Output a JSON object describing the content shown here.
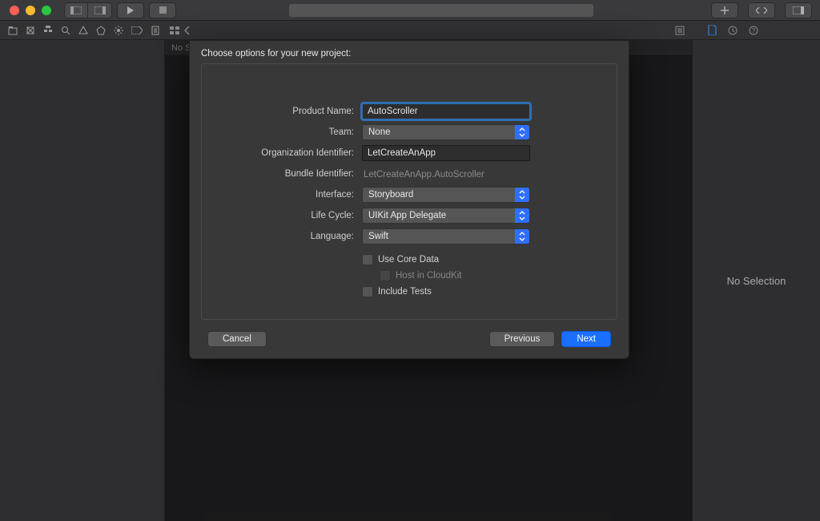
{
  "editor_path": "No Selection",
  "inspector_empty": "No Selection",
  "sheet": {
    "title": "Choose options for your new project:",
    "product_name_label": "Product Name:",
    "product_name_value": "AutoScroller",
    "team_label": "Team:",
    "team_value": "None",
    "org_id_label": "Organization Identifier:",
    "org_id_value": "LetCreateAnApp",
    "bundle_id_label": "Bundle Identifier:",
    "bundle_id_value": "LetCreateAnApp.AutoScroller",
    "interface_label": "Interface:",
    "interface_value": "Storyboard",
    "lifecycle_label": "Life Cycle:",
    "lifecycle_value": "UIKit App Delegate",
    "language_label": "Language:",
    "language_value": "Swift",
    "use_core_data_label": "Use Core Data",
    "host_cloudkit_label": "Host in CloudKit",
    "include_tests_label": "Include Tests",
    "cancel": "Cancel",
    "previous": "Previous",
    "next": "Next"
  }
}
